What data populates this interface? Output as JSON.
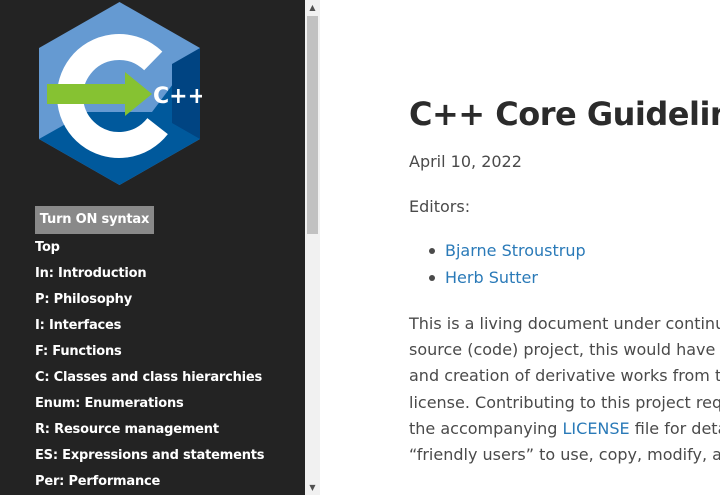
{
  "sidebar": {
    "logo_text": "C++",
    "syntax_button": "Turn ON syntax",
    "items": [
      {
        "label": "Top"
      },
      {
        "label": "In: Introduction"
      },
      {
        "label": "P: Philosophy"
      },
      {
        "label": "I: Interfaces"
      },
      {
        "label": "F: Functions"
      },
      {
        "label": "C: Classes and class hierarchies"
      },
      {
        "label": "Enum: Enumerations"
      },
      {
        "label": "R: Resource management"
      },
      {
        "label": "ES: Expressions and statements"
      },
      {
        "label": "Per: Performance"
      }
    ]
  },
  "scrollbar": {
    "up_arrow": "▲",
    "down_arrow": "▼"
  },
  "main": {
    "title": "C++ Core Guidelines",
    "date": "April 10, 2022",
    "editors_label": "Editors:",
    "editors": [
      {
        "name": "Bjarne Stroustrup"
      },
      {
        "name": "Herb Sutter"
      }
    ],
    "paragraph_lines": [
      {
        "before": "This is a living document under continuo",
        "link": "",
        "after": ""
      },
      {
        "before": "source (code) project, this would have be",
        "link": "",
        "after": ""
      },
      {
        "before": "and creation of derivative works from thi",
        "link": "",
        "after": ""
      },
      {
        "before": "license. Contributing to this project requi",
        "link": "",
        "after": ""
      },
      {
        "before": "the accompanying ",
        "link": "LICENSE",
        "after": " file for detail"
      },
      {
        "before": "“friendly users” to use, copy, modify, and d",
        "link": "",
        "after": ""
      }
    ]
  },
  "colors": {
    "sidebar_bg": "#232323",
    "link": "#2a7ab8",
    "logo_light_blue": "#659ad2",
    "logo_dark_blue": "#00599c",
    "logo_green": "#86c232"
  }
}
